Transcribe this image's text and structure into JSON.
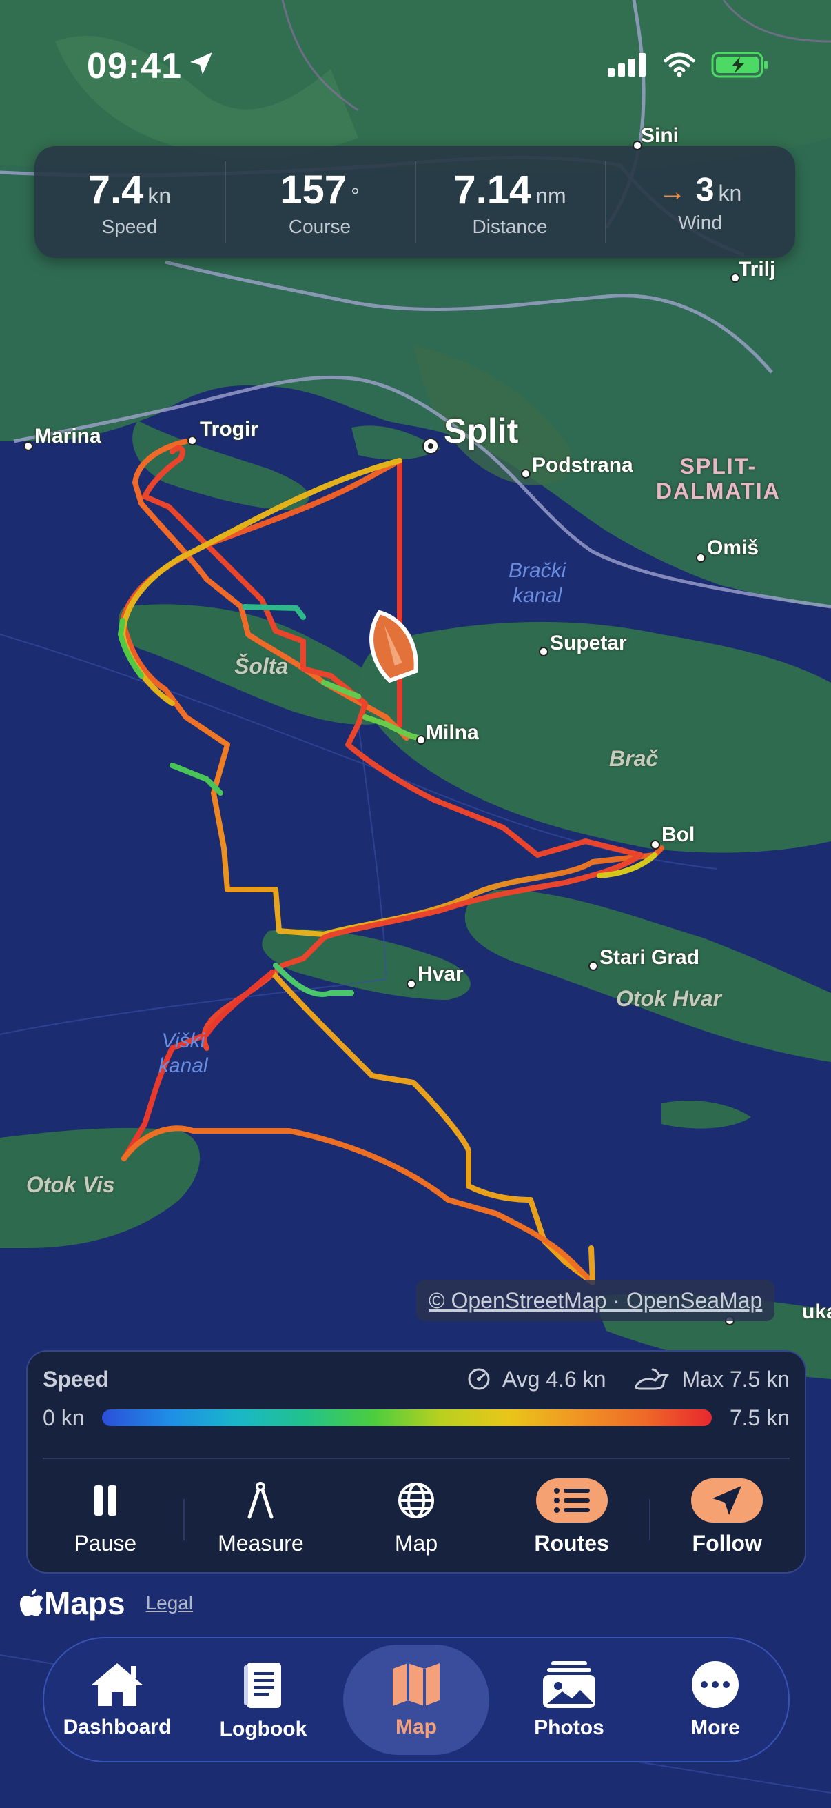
{
  "status_bar": {
    "time": "09:41"
  },
  "stats": [
    {
      "value": "7.4",
      "unit": "kn",
      "label": "Speed"
    },
    {
      "value": "157",
      "unit": "°",
      "label": "Course"
    },
    {
      "value": "7.14",
      "unit": "nm",
      "label": "Distance"
    },
    {
      "value": "3",
      "unit": "kn",
      "label": "Wind"
    }
  ],
  "map": {
    "places": {
      "sini": "Sini",
      "trilj": "Trilj",
      "marina": "Marina",
      "trogir": "Trogir",
      "split": "Split",
      "podstrana": "Podstrana",
      "omis": "Omiš",
      "supetar": "Supetar",
      "milna": "Milna",
      "bol": "Bol",
      "hvar": "Hvar",
      "stari_grad": "Stari Grad",
      "edge": "uka"
    },
    "region": {
      "line1": "SPLIT-",
      "line2": "DALMATIA"
    },
    "water": {
      "bracki_1": "Brački",
      "bracki_2": "kanal",
      "viski_1": "Viški",
      "viski_2": "kanal"
    },
    "islands": {
      "solta": "Šolta",
      "brac": "Brač",
      "otok_hvar": "Otok Hvar",
      "otok_vis": "Otok Vis"
    },
    "attribution": "© OpenStreetMap · OpenSeaMap"
  },
  "speed_panel": {
    "title": "Speed",
    "avg": "Avg 4.6 kn",
    "max": "Max 7.5 kn",
    "min_label": "0 kn",
    "max_label": "7.5 kn"
  },
  "tools": [
    {
      "label": "Pause",
      "icon": "pause-icon"
    },
    {
      "label": "Measure",
      "icon": "compass-icon"
    },
    {
      "label": "Map",
      "icon": "globe-icon"
    },
    {
      "label": "Routes",
      "icon": "list-icon"
    },
    {
      "label": "Follow",
      "icon": "location-arrow-icon"
    }
  ],
  "footer": {
    "brand": "Maps",
    "legal": "Legal"
  },
  "tabs": [
    {
      "label": "Dashboard",
      "icon": "house-icon"
    },
    {
      "label": "Logbook",
      "icon": "book-icon"
    },
    {
      "label": "Map",
      "icon": "map-icon"
    },
    {
      "label": "Photos",
      "icon": "photos-icon"
    },
    {
      "label": "More",
      "icon": "ellipsis-icon"
    }
  ],
  "colors": {
    "accent": "#f6a171",
    "track_high": "#e8272e",
    "track_low": "#2b4fd9",
    "boat": "#e2723a"
  }
}
